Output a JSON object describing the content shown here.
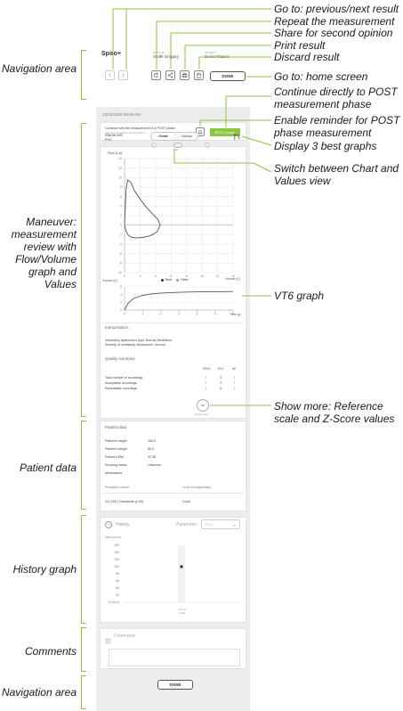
{
  "app": {
    "logo": "Spiro+",
    "doctor_label": "DOCTOR",
    "doctor_name": "Smith Gregory",
    "patient_label": "PATIENT",
    "patient_name": "Demo Patient",
    "done_label": "DONE",
    "datetime": "13/10/2022 08:46 AM"
  },
  "post_phase": {
    "text": "Continue with the measurement in a POST phase",
    "subtext": "after bronchodilator administration",
    "button": "POST phase"
  },
  "maneuver": {
    "label": "Maneuver",
    "value": "FVC",
    "tab_chart": "Chart",
    "tab_values": "Values",
    "pef": "PEF",
    "flow_label": "Flow [L/s]",
    "volume_label": "Volume [L]",
    "legend_best": "Best",
    "legend_other": "Other",
    "vt_label": "Volume [L]",
    "time_label": "Time (s)"
  },
  "chart_data": [
    {
      "type": "line",
      "title": "",
      "xlabel": "Volume [L]",
      "ylabel": "Flow [L/s]",
      "xlim": [
        0,
        14
      ],
      "ylim": [
        -10,
        14
      ],
      "x_ticks": [
        "0",
        "2",
        "4",
        "6",
        "8",
        "10",
        "12",
        "14"
      ],
      "y_ticks": [
        "14",
        "12",
        "10",
        "8",
        "6",
        "4",
        "2",
        "0",
        "-2",
        "-4",
        "-6",
        "-8",
        "-10"
      ],
      "series": [
        {
          "name": "Best",
          "x": [
            0,
            0.2,
            0.4,
            0.8,
            1.3,
            2,
            2.8,
            3.6,
            4.3,
            4.6,
            4.2,
            3.6,
            3,
            2.3,
            1.6,
            1,
            0.5,
            0.2,
            0
          ],
          "y": [
            0,
            7.5,
            9.5,
            9,
            7.2,
            5.5,
            3.8,
            2.4,
            1.2,
            0,
            -1.4,
            -2,
            -2.4,
            -2.6,
            -2.7,
            -2.6,
            -2.2,
            -1.2,
            0
          ]
        }
      ]
    },
    {
      "type": "line",
      "title": "",
      "xlabel": "Time (s)",
      "ylabel": "Volume [L]",
      "xlim": [
        0,
        6
      ],
      "ylim": [
        0,
        6
      ],
      "x_ticks": [
        "0",
        "1",
        "2",
        "3",
        "4",
        "5",
        "6"
      ],
      "y_ticks": [
        "6",
        "4",
        "2",
        "0"
      ],
      "series": [
        {
          "name": "Best",
          "x": [
            0,
            0.2,
            0.5,
            1,
            1.5,
            2,
            3,
            4,
            5,
            6
          ],
          "y": [
            0,
            1.8,
            3,
            3.8,
            4.2,
            4.4,
            4.6,
            4.7,
            4.75,
            4.8
          ]
        }
      ]
    },
    {
      "type": "scatter",
      "title": "",
      "xlabel": "",
      "ylabel": "FEV1 [%LLN]",
      "ylim": [
        0,
        160
      ],
      "y_ticks": [
        "160",
        "140",
        "120",
        "100",
        "80",
        "60",
        "40",
        "20",
        "0 %LLN"
      ],
      "x_labels": [
        "13 Oct 2022"
      ],
      "series": [
        {
          "name": "",
          "values": [
            100
          ]
        }
      ]
    }
  ],
  "interpretation": {
    "title": "Interpretation",
    "line1": "Ventilatory dysfunction type: Normal Ventilation",
    "line2": "Severity of ventilatory disturbance: Normal"
  },
  "quality": {
    "title": "Quality summary",
    "columns": [
      "FEV1",
      "FVC",
      "dC"
    ],
    "rows": [
      {
        "label": "Total number of recordings",
        "v1": "/",
        "v2": "3",
        "v3": "/"
      },
      {
        "label": "Acceptable recordings",
        "v1": "/",
        "v2": "3",
        "v3": "/"
      },
      {
        "label": "Repeatable recordings",
        "v1": "/",
        "v2": "3",
        "v3": "/"
      }
    ],
    "show_more": "Show more"
  },
  "patient": {
    "title": "Patient data",
    "rows": [
      {
        "label": "Patient's height",
        "value": "180.0"
      },
      {
        "label": "Patient's weight",
        "value": "80.0"
      },
      {
        "label": "Patient's BMI",
        "value": "32.38"
      },
      {
        "label": "Smoking status",
        "value": "Unknown"
      },
      {
        "label": "Medications",
        "value": ""
      }
    ],
    "prediction_label": "Prediction model",
    "prediction_value": "GLI 2012 Caucasian (2-94)",
    "cooperation_label": "Level of cooperation",
    "cooperation_value": "Good"
  },
  "history": {
    "title": "History",
    "parameter_label": "Parameter",
    "parameter_value": "FEV1",
    "axis_title": "FEV1 [%LLN]",
    "x_label": "13 Oct 2022"
  },
  "comments": {
    "title": "Comments"
  },
  "bottom": {
    "done_label": "DONE"
  },
  "callouts": {
    "prev_next": "Go to: previous/next result",
    "repeat": "Repeat the measurement",
    "share": "Share for second opinion",
    "print": "Print result",
    "discard": "Discard result",
    "home": "Go to: home screen",
    "post_direct": "Continue directly to POST measurement phase",
    "reminder": "Enable reminder for POST phase measurement",
    "best_graphs": "Display 3 best graphs",
    "switch_view": "Switch between Chart and Values view",
    "vt6": "VT6 graph",
    "show_more": "Show more: Reference scale and Z-Score values"
  },
  "left_labels": {
    "navigation": "Navigation area",
    "maneuver": "Maneuver: measurement review with Flow/Volume graph and Values",
    "patient": "Patient data",
    "history": "History graph",
    "comments": "Comments",
    "navigation_bottom": "Navigation area"
  },
  "colors": {
    "accent": "#8cc63f",
    "background": "#eceeed",
    "curve": "#555555"
  }
}
